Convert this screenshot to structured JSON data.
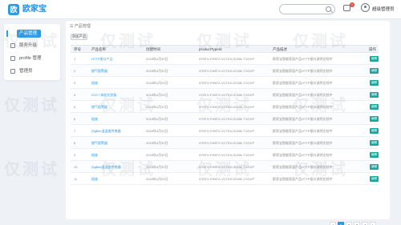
{
  "header": {
    "logo_letter": "欧",
    "logo_text": "欧家宝",
    "search_placeholder": "",
    "badge_count": "1",
    "user_name": "超级管理员"
  },
  "sidebar": {
    "items": [
      {
        "label": "产品管理",
        "icon": "grid-icon",
        "active": true
      },
      {
        "label": "服务升级",
        "icon": "upgrade-icon",
        "active": false
      },
      {
        "label": "profile 管理",
        "icon": "profile-icon",
        "active": false
      },
      {
        "label": "管理员",
        "icon": "admin-icon",
        "active": false
      }
    ]
  },
  "main": {
    "breadcrumb": "☰  产品管理",
    "add_button": "添加产品",
    "columns": [
      "序号",
      "产品名称",
      "创建时间",
      "productTypeId",
      "产品描述",
      "操作"
    ],
    "rows": [
      {
        "idx": "1",
        "name": "HTTP接口产品",
        "time": "2018年4月20日",
        "type_id": "HT8TX-FH8TX-VCTK9-GCI8K-TXGXP",
        "desc": "欧家宝智能家居产品HTTP接口说明文档中",
        "action": "编辑"
      },
      {
        "idx": "2",
        "name": "燃气报警器",
        "time": "2018年4月20日",
        "type_id": "HT8TX-FH8TX-VCTK9-GCI8K-TXGXP",
        "desc": "欧家宝智能家居产品HTTP接口说明文档中",
        "action": "编辑"
      },
      {
        "idx": "3",
        "name": "插座",
        "time": "2018年4月20日",
        "type_id": "HT8TX-FH8TX-VCTK9-GCI8K-TXGXP",
        "desc": "欧家宝智能家居产品HTTP接口说明文档中",
        "action": "编辑"
      },
      {
        "idx": "4",
        "name": "ZGJ一体化光伏板",
        "time": "2018年4月20日",
        "type_id": "HT8TX-FH8TX-VCTK9-GCI8K-TXGXP",
        "desc": "欧家宝智能家居产品HTTP接口说明文档中",
        "action": "编辑"
      },
      {
        "idx": "5",
        "name": "燃气报警器",
        "time": "2018年4月20日",
        "type_id": "HT8TX-FH8TX-VCTK9-GCI8K-TXGXP",
        "desc": "欧家宝智能家居产品HTTP接口说明文档中",
        "action": "编辑"
      },
      {
        "idx": "6",
        "name": "插座",
        "time": "2018年4月20日",
        "type_id": "HT8TX-FH8TX-VCTK9-GCI8K-TXGXP",
        "desc": "欧家宝智能家居产品HTTP接口说明文档中",
        "action": "编辑"
      },
      {
        "idx": "7",
        "name": "ZigBee温湿度传感器",
        "time": "2018年4月20日",
        "type_id": "HT8TX-FH8TX-VCTK9-GCI8K-TXGXP",
        "desc": "欧家宝智能家居产品HTTP接口说明文档中",
        "action": "编辑"
      },
      {
        "idx": "8",
        "name": "燃气报警器",
        "time": "2018年4月20日",
        "type_id": "HT8TX-FH8TX-VCTK9-GCI8K-TXGXP",
        "desc": "欧家宝智能家居产品HTTP接口说明文档中",
        "action": "编辑"
      },
      {
        "idx": "9",
        "name": "插座",
        "time": "2018年4月20日",
        "type_id": "HT8TX-FH8TX-VCTK9-GCI8K-TXGXP",
        "desc": "欧家宝智能家居产品HTTP接口说明文档中",
        "action": "编辑"
      },
      {
        "idx": "10",
        "name": "ZigBee温湿度传感器",
        "time": "2018年4月20日",
        "type_id": "HT8TX-FH8TX-VCTK9-GCI8K-TXGXP",
        "desc": "欧家宝智能家居产品HTTP接口说明文档中",
        "action": "编辑"
      },
      {
        "idx": "11",
        "name": "插座",
        "time": "2018年4月20日",
        "type_id": "HT8TX-FH8TX-VCTK9-GCI8K-TXGXP",
        "desc": "欧家宝智能家居产品HTTP接口说明文档中",
        "action": "编辑"
      }
    ]
  },
  "pagination": {
    "pages": [
      "<",
      "1",
      "2",
      "3",
      "4",
      ">"
    ],
    "active": "1"
  },
  "watermark": {
    "text": "仅测试"
  },
  "colors": {
    "accent": "#2c9be6",
    "edit_button": "#1aa5a0",
    "badge": "#e74c3c"
  }
}
